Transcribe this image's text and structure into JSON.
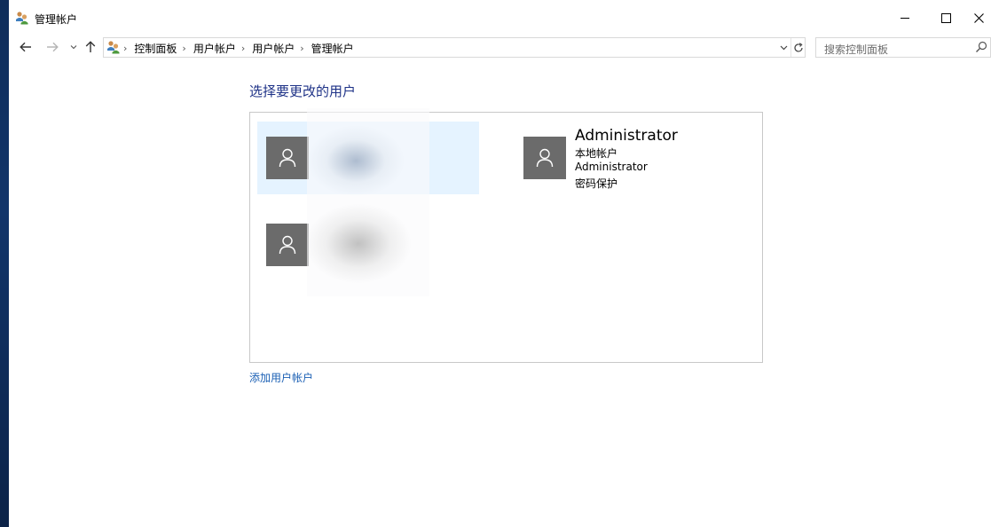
{
  "window": {
    "title": "管理帐户",
    "icon": "users-control-panel-icon"
  },
  "address_bar": {
    "breadcrumbs": [
      "控制面板",
      "用户帐户",
      "用户帐户",
      "管理帐户"
    ]
  },
  "search": {
    "placeholder": "搜索控制面板"
  },
  "main": {
    "heading": "选择要更改的用户",
    "accounts": [
      {
        "name": "",
        "type": "",
        "detail": "",
        "password": "",
        "selected": true,
        "redacted": true
      },
      {
        "name": "",
        "type": "",
        "detail": "",
        "password": "",
        "selected": false,
        "redacted": true
      },
      {
        "name": "Administrator",
        "type": "本地帐户",
        "detail": "Administrator",
        "password": "密码保护",
        "selected": false,
        "redacted": false
      }
    ],
    "add_account_link": "添加用户帐户"
  },
  "colors": {
    "heading": "#1e3287",
    "link": "#1a5fb4",
    "selected_bg": "#e5f3ff",
    "avatar_bg": "#6b6b6b"
  }
}
